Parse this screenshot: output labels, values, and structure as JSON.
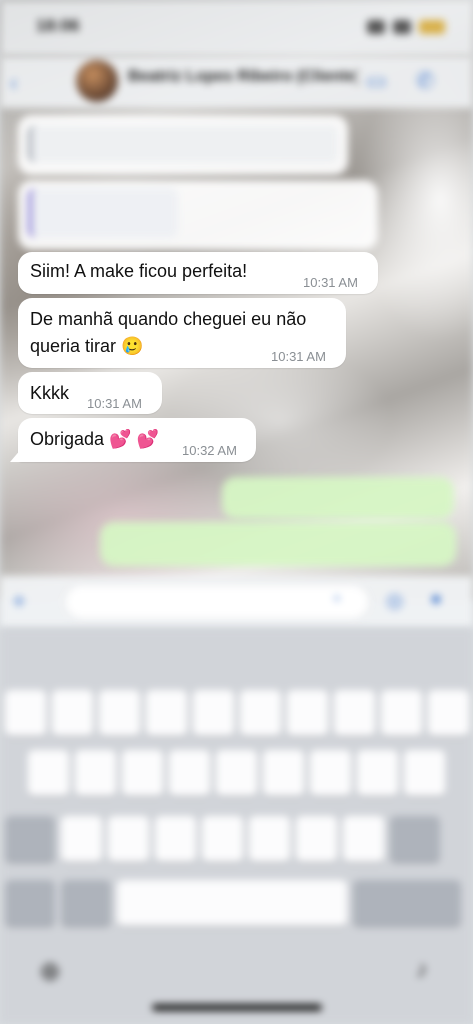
{
  "status_bar": {
    "time": "18:06"
  },
  "header": {
    "back_icon": "chevron-left-icon",
    "contact_name": "Beatriz Lopes Ribeiro (Cliente)",
    "video_icon": "video-camera-icon",
    "call_icon": "phone-icon"
  },
  "messages": [
    {
      "direction": "incoming",
      "text": "Siim! A make ficou perfeita!",
      "time": "10:31 AM"
    },
    {
      "direction": "incoming",
      "text": "De manhã quando cheguei eu não queria tirar 🥲",
      "time": "10:31 AM"
    },
    {
      "direction": "incoming",
      "text": "Kkkk",
      "time": "10:31 AM"
    },
    {
      "direction": "incoming",
      "text": "Obrigada 💕 💕",
      "time": "10:32 AM"
    }
  ],
  "input_bar": {
    "plus_icon": "plus-icon",
    "sticker_icon": "sticker-icon",
    "camera_icon": "camera-icon",
    "mic_icon": "microphone-icon"
  },
  "keyboard": {
    "globe_icon": "globe-icon",
    "dictation_icon": "microphone-icon"
  },
  "colors": {
    "accent": "#4a7fd0",
    "incoming_bubble": "#ffffff",
    "outgoing_bubble": "#d6f5c4",
    "timestamp": "#8a8f94"
  }
}
